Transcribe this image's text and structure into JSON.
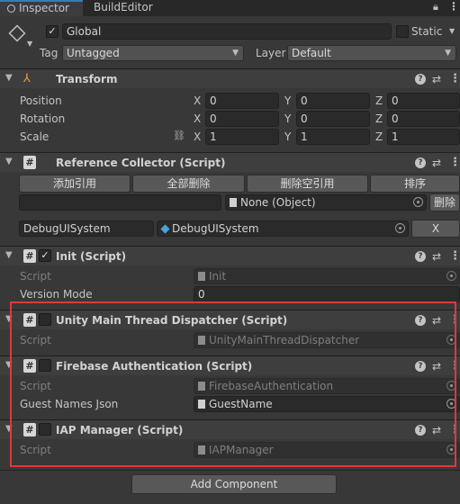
{
  "tabs": {
    "inspector": "Inspector",
    "build_editor": "BuildEditor"
  },
  "gameobject": {
    "name": "Global",
    "static_label": "Static",
    "tag_label": "Tag",
    "tag_value": "Untagged",
    "layer_label": "Layer",
    "layer_value": "Default"
  },
  "transform": {
    "title": "Transform",
    "position": {
      "label": "Position",
      "x": "0",
      "y": "0",
      "z": "0"
    },
    "rotation": {
      "label": "Rotation",
      "x": "0",
      "y": "0",
      "z": "0"
    },
    "scale": {
      "label": "Scale",
      "x": "1",
      "y": "1",
      "z": "1"
    },
    "axis_x": "X",
    "axis_y": "Y",
    "axis_z": "Z"
  },
  "reference_collector": {
    "title": "Reference Collector (Script)",
    "add_ref": "添加引用",
    "delete_all": "全部删除",
    "delete_empty": "删除空引用",
    "sort": "排序",
    "none_object": "None (Object)",
    "delete": "删除",
    "entry_key": "DebugUISystem",
    "entry_value": "DebugUISystem",
    "entry_remove": "X"
  },
  "init": {
    "title": "Init (Script)",
    "script_label": "Script",
    "script_value": "Init",
    "version_mode_label": "Version Mode",
    "version_mode_value": "0"
  },
  "dispatcher": {
    "title": "Unity Main Thread Dispatcher (Script)",
    "script_label": "Script",
    "script_value": "UnityMainThreadDispatcher"
  },
  "firebase": {
    "title": "Firebase Authentication (Script)",
    "script_label": "Script",
    "script_value": "FirebaseAuthentication",
    "guest_label": "Guest Names Json",
    "guest_value": "GuestName"
  },
  "iap": {
    "title": "IAP Manager (Script)",
    "script_label": "Script",
    "script_value": "IAPManager"
  },
  "add_component": "Add Component",
  "colors": {
    "highlight": "#e03838",
    "accent": "#3a79bb"
  }
}
